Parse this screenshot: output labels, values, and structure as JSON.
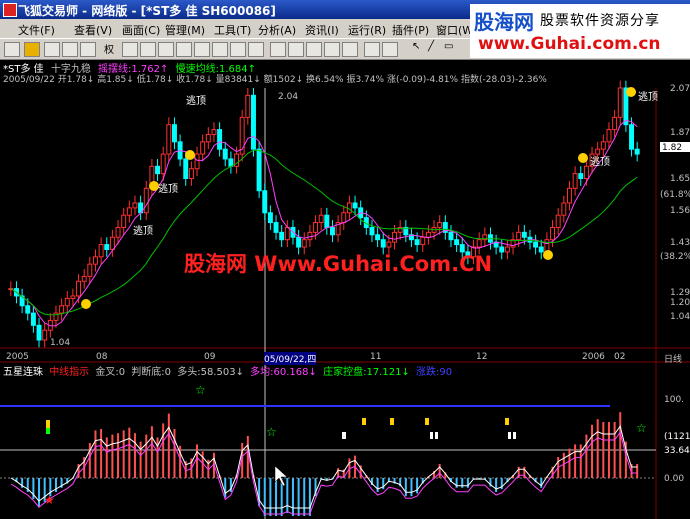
{
  "window": {
    "title": "飞狐交易师 - 网络版 - [*ST多 佳 SH600086]"
  },
  "menu": [
    "文件(F)",
    "查看(V)",
    "画面(C)",
    "管理(M)",
    "工具(T)",
    "分析(A)",
    "资讯(I)",
    "运行(R)",
    "插件(P)",
    "窗口(W)"
  ],
  "toolbar": {
    "weight_label": "权"
  },
  "brand": {
    "name": "股海网",
    "slogan": "股票软件资源分享",
    "url": "www.Guhai.com.cn"
  },
  "watermark": "股海网 Www.Guhai.Com.CN",
  "main_chart": {
    "legend": {
      "stock": "*ST多 佳",
      "indicator": "十字九稳",
      "osc_label": "摇摆线:",
      "osc_value": "1.762↑",
      "ma_label": "慢速均线:",
      "ma_value": "1.684↑"
    },
    "quote": {
      "date": "2005/09/22",
      "open": "开1.78↓",
      "high": "高1.85↓",
      "low": "低1.78↓",
      "close": "收1.78↓",
      "volume": "量83841↓",
      "amount": "额1502↓",
      "turnover": "换6.54%",
      "amplitude": "振3.74%",
      "change": "涨(-0.09)-4.81%",
      "index": "指数(-28.03)-2.36%"
    },
    "annotations": {
      "escape1": "逃顶",
      "escape2": "逃顶",
      "escape3": "逃顶",
      "escape4": "逃顶",
      "escape5": "逃顶",
      "low": "1.04",
      "peak": "2.04"
    },
    "price_axis": [
      "2.07",
      "1.87",
      "1.82",
      "1.65",
      "(61.8%)",
      "1.56",
      "1.43",
      "(38.2%)",
      "1.29",
      "1.20",
      "1.04"
    ],
    "date_axis": [
      "2005",
      "08",
      "09",
      "05/09/22,四",
      "11",
      "12",
      "2006",
      "02",
      "日线"
    ]
  },
  "sub_chart": {
    "legend": {
      "name": "五星连珠",
      "gold": "中线指示",
      "golden_cross": "金叉:0",
      "bottom": "判断底:0",
      "bull": "多头:58.503↓",
      "bull_ma": "多均:60.168↓",
      "dealer": "庄家控盘:17.121↓",
      "rise": "涨跌:90"
    },
    "axis": [
      "100.",
      "(1121)",
      "33.64",
      "0.00"
    ]
  },
  "chart_data": {
    "type": "candlestick",
    "title": "十字九稳",
    "categories": [
      "2005-07",
      "2005-07",
      "2005-07",
      "2005-07",
      "2005-07",
      "2005-07",
      "2005-08",
      "2005-08",
      "2005-08",
      "2005-08",
      "2005-08",
      "2005-08",
      "2005-08",
      "2005-08",
      "2005-08",
      "2005-08",
      "2005-08",
      "2005-08",
      "2005-08",
      "2005-08",
      "2005-08",
      "2005-08",
      "2005-08",
      "2005-08",
      "2005-09",
      "2005-09",
      "2005-09",
      "2005-09",
      "2005-09",
      "2005-09",
      "2005-09",
      "2005-09",
      "2005-09",
      "2005-09",
      "2005-09",
      "2005-09",
      "2005-09",
      "2005-09",
      "2005-09",
      "2005-09",
      "2005-09",
      "2005-09",
      "2005-09",
      "2005-10",
      "2005-10",
      "2005-10",
      "2005-10",
      "2005-10",
      "2005-10",
      "2005-10",
      "2005-10",
      "2005-10",
      "2005-10",
      "2005-10",
      "2005-10",
      "2005-10",
      "2005-10",
      "2005-10",
      "2005-10",
      "2005-11",
      "2005-11",
      "2005-11",
      "2005-11",
      "2005-11",
      "2005-11",
      "2005-11",
      "2005-11",
      "2005-11",
      "2005-11",
      "2005-11",
      "2005-11",
      "2005-11",
      "2005-11",
      "2005-11",
      "2005-11",
      "2005-11",
      "2005-11",
      "2005-12",
      "2005-12",
      "2005-12",
      "2005-12",
      "2005-12",
      "2005-12",
      "2005-12",
      "2005-12",
      "2005-12",
      "2005-12",
      "2005-12",
      "2005-12",
      "2005-12",
      "2005-12",
      "2005-12",
      "2005-12",
      "2005-12",
      "2006-01",
      "2006-01",
      "2006-01",
      "2006-01",
      "2006-01",
      "2006-01",
      "2006-01",
      "2006-01",
      "2006-02",
      "2006-02",
      "2006-02",
      "2006-02",
      "2006-02",
      "2006-02",
      "2006-02",
      "2006-02",
      "2006-02"
    ],
    "close": [
      1.25,
      1.22,
      1.18,
      1.15,
      1.1,
      1.04,
      1.08,
      1.12,
      1.15,
      1.18,
      1.21,
      1.22,
      1.28,
      1.3,
      1.35,
      1.38,
      1.43,
      1.41,
      1.46,
      1.5,
      1.55,
      1.58,
      1.6,
      1.56,
      1.66,
      1.75,
      1.72,
      1.8,
      1.92,
      1.85,
      1.78,
      1.7,
      1.74,
      1.8,
      1.85,
      1.88,
      1.9,
      1.82,
      1.78,
      1.75,
      1.8,
      1.95,
      2.04,
      1.82,
      1.65,
      1.56,
      1.52,
      1.48,
      1.45,
      1.5,
      1.46,
      1.42,
      1.45,
      1.48,
      1.52,
      1.55,
      1.5,
      1.47,
      1.52,
      1.56,
      1.6,
      1.58,
      1.54,
      1.5,
      1.47,
      1.45,
      1.42,
      1.44,
      1.48,
      1.5,
      1.47,
      1.45,
      1.43,
      1.46,
      1.48,
      1.5,
      1.52,
      1.48,
      1.45,
      1.43,
      1.4,
      1.38,
      1.42,
      1.45,
      1.47,
      1.44,
      1.42,
      1.4,
      1.42,
      1.45,
      1.48,
      1.46,
      1.44,
      1.42,
      1.4,
      1.45,
      1.5,
      1.55,
      1.6,
      1.66,
      1.72,
      1.7,
      1.75,
      1.8,
      1.82,
      1.85,
      1.9,
      1.95,
      2.07,
      1.92,
      1.82,
      1.8
    ],
    "ma_fast_label": "摇摆线",
    "ma_slow_label": "慢速均线",
    "ylim": [
      1.04,
      2.07
    ]
  }
}
